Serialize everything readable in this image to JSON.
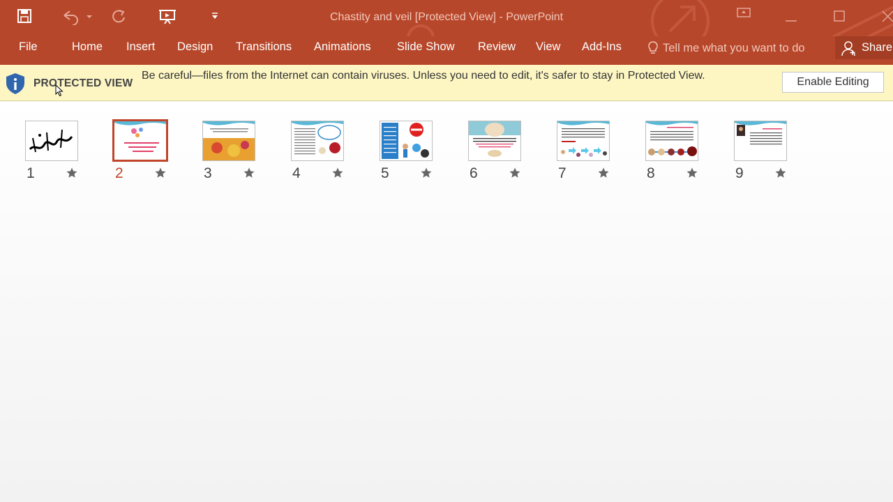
{
  "window": {
    "title": "Chastity and veil [Protected View] - PowerPoint"
  },
  "qat": [
    {
      "name": "save-icon"
    },
    {
      "name": "undo-icon"
    },
    {
      "name": "redo-icon"
    },
    {
      "name": "start-from-beginning-icon"
    },
    {
      "name": "customize-qat-icon"
    }
  ],
  "ribbon": {
    "tabs": [
      "File",
      "Home",
      "Insert",
      "Design",
      "Transitions",
      "Animations",
      "Slide Show",
      "Review",
      "View",
      "Add-Ins"
    ],
    "tell_me": "Tell me what you want to do",
    "share": "Share"
  },
  "protected_view": {
    "label": "PROTECTED VIEW",
    "message": "Be careful—files from the Internet can contain viruses. Unless you need to edit, it's safer to stay in Protected View.",
    "button": "Enable Editing"
  },
  "slides": [
    {
      "number": "1",
      "selected": false
    },
    {
      "number": "2",
      "selected": true
    },
    {
      "number": "3",
      "selected": false
    },
    {
      "number": "4",
      "selected": false
    },
    {
      "number": "5",
      "selected": false
    },
    {
      "number": "6",
      "selected": false
    },
    {
      "number": "7",
      "selected": false
    },
    {
      "number": "8",
      "selected": false
    },
    {
      "number": "9",
      "selected": false
    }
  ],
  "colors": {
    "accent": "#b7472a",
    "message_bar": "#fdf6c3",
    "selection": "#c0452b"
  }
}
